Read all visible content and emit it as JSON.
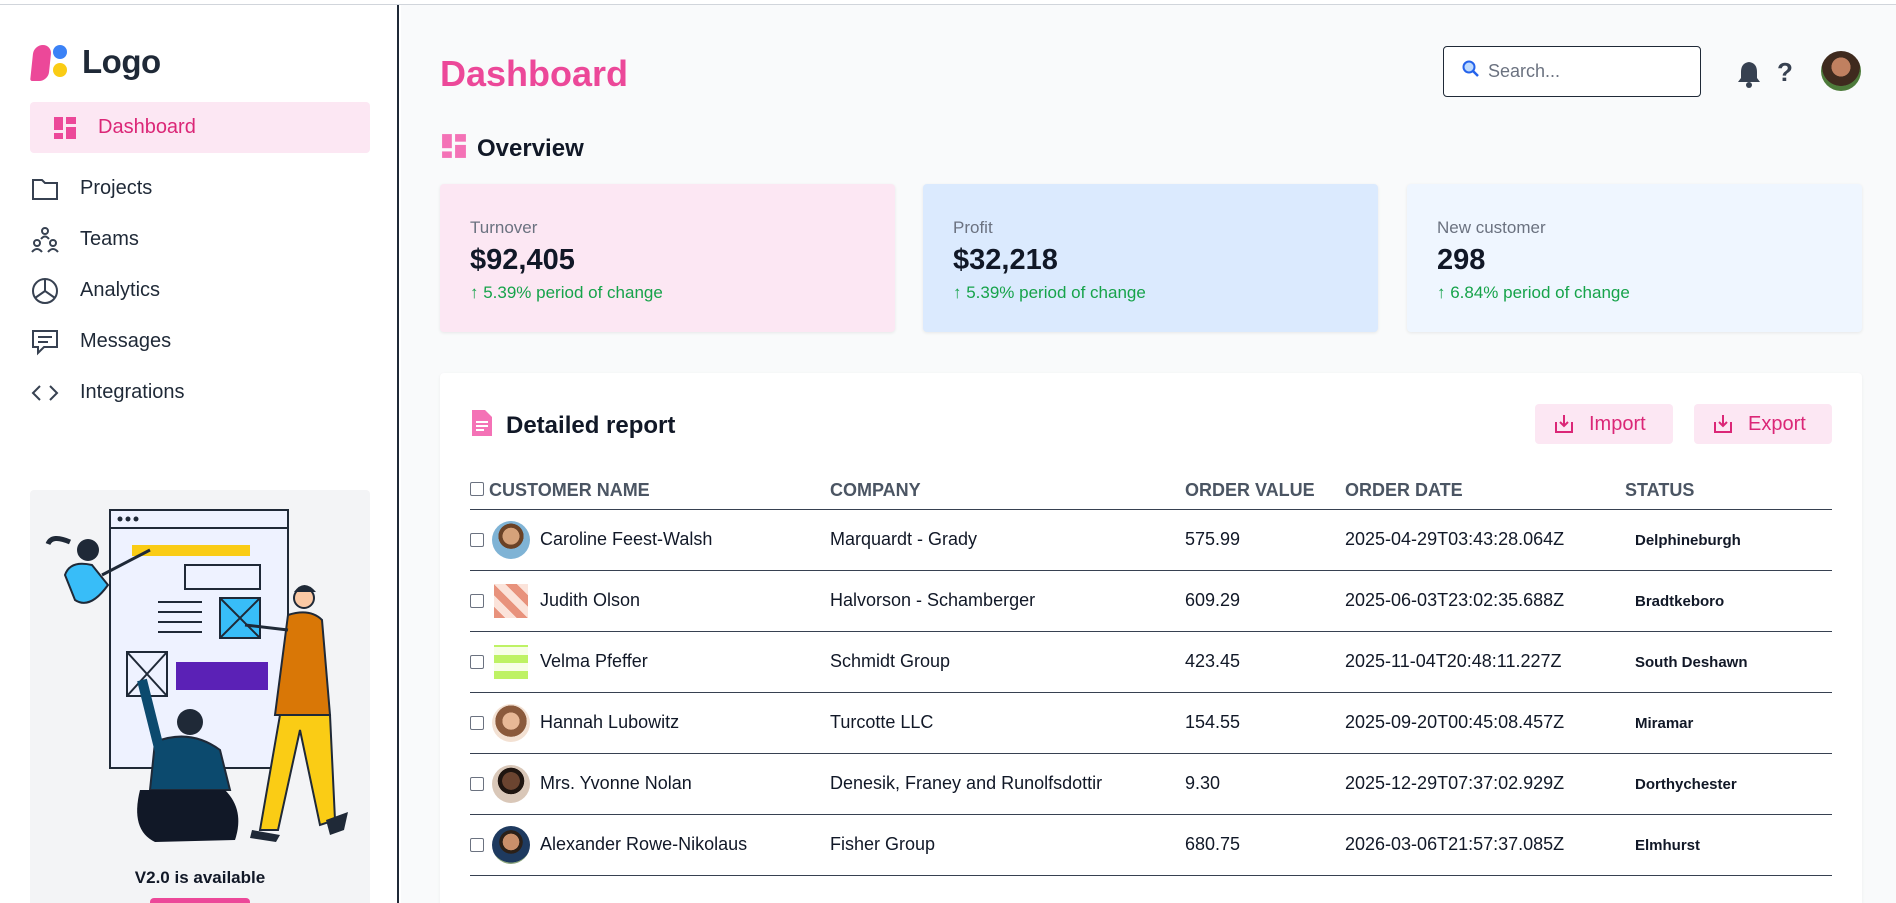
{
  "brand": {
    "logo_text": "Logo",
    "colors": {
      "accent": "#ec4899",
      "blue": "#3b82f6",
      "yellow": "#facc15"
    }
  },
  "sidebar": {
    "items": [
      {
        "label": "Dashboard",
        "icon": "dashboard-icon",
        "active": true
      },
      {
        "label": "Projects",
        "icon": "folder-icon"
      },
      {
        "label": "Teams",
        "icon": "teams-icon"
      },
      {
        "label": "Analytics",
        "icon": "pie-chart-icon"
      },
      {
        "label": "Messages",
        "icon": "message-icon"
      },
      {
        "label": "Integrations",
        "icon": "code-icon"
      }
    ],
    "promo": {
      "label": "V2.0 is available"
    }
  },
  "header": {
    "title": "Dashboard",
    "search_placeholder": "Search...",
    "help_label": "?"
  },
  "overview": {
    "title": "Overview",
    "cards": [
      {
        "label": "Turnover",
        "value": "$92,405",
        "change": "↑ 5.39% period of change"
      },
      {
        "label": "Profit",
        "value": "$32,218",
        "change": "↑ 5.39% period of change"
      },
      {
        "label": "New customer",
        "value": "298",
        "change": "↑ 6.84% period of change"
      }
    ]
  },
  "report": {
    "title": "Detailed report",
    "import_label": "Import",
    "export_label": "Export",
    "columns": [
      "CUSTOMER NAME",
      "COMPANY",
      "ORDER VALUE",
      "ORDER DATE",
      "STATUS"
    ],
    "rows": [
      {
        "name": "Caroline Feest-Walsh",
        "company": "Marquardt - Grady",
        "value": "575.99",
        "date": "2025-04-29T03:43:28.064Z",
        "status": "Delphineburgh"
      },
      {
        "name": "Judith Olson",
        "company": "Halvorson - Schamberger",
        "value": "609.29",
        "date": "2025-06-03T23:02:35.688Z",
        "status": "Bradtkeboro"
      },
      {
        "name": "Velma Pfeffer",
        "company": "Schmidt Group",
        "value": "423.45",
        "date": "2025-11-04T20:48:11.227Z",
        "status": "South Deshawn"
      },
      {
        "name": "Hannah Lubowitz",
        "company": "Turcotte LLC",
        "value": "154.55",
        "date": "2025-09-20T00:45:08.457Z",
        "status": "Miramar"
      },
      {
        "name": "Mrs. Yvonne Nolan",
        "company": "Denesik, Franey and Runolfsdottir",
        "value": "9.30",
        "date": "2025-12-29T07:37:02.929Z",
        "status": "Dorthychester"
      },
      {
        "name": "Alexander Rowe-Nikolaus",
        "company": "Fisher Group",
        "value": "680.75",
        "date": "2026-03-06T21:57:37.085Z",
        "status": "Elmhurst"
      }
    ]
  }
}
